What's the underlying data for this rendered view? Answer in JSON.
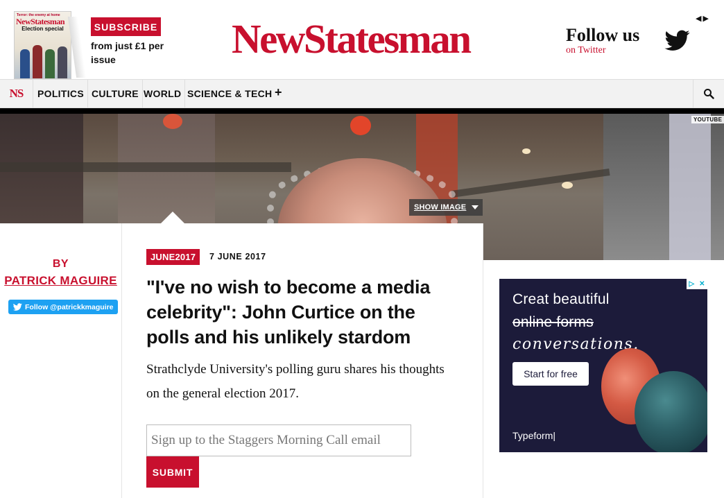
{
  "header": {
    "cover": {
      "top_line": "Terror: the enemy at home",
      "masthead": "NewStatesman",
      "headline": "Election special"
    },
    "subscribe_label": "SUBSCRIBE",
    "subscribe_price": "from just £1 per issue",
    "logo": "NewStatesman",
    "follow_title": "Follow us",
    "follow_sub": "on Twitter",
    "carousel_arrows": "◀▶"
  },
  "nav": {
    "logo": "NS",
    "items": [
      "POLITICS",
      "CULTURE",
      "WORLD",
      "SCIENCE & TECH"
    ],
    "more": "+"
  },
  "hero": {
    "youtube_tag": "YOUTUBE",
    "show_image_label": "SHOW IMAGE"
  },
  "byline": {
    "by": "BY",
    "author": "PATRICK MAGUIRE",
    "twitter_follow": "Follow @patrickkmaguire"
  },
  "article": {
    "tag": "JUNE2017",
    "date": "7 JUNE 2017",
    "headline": "\"I've no wish to become a media celebrity\": John Curtice on the polls and his unlikely stardom",
    "standfirst": "Strathclyde University's polling guru shares his thoughts on the general election 2017.",
    "email_placeholder": "Sign up to the Staggers Morning Call email",
    "submit_label": "SUBMIT"
  },
  "ad": {
    "line1": "Creat beautiful",
    "line2": "online forms",
    "line3": "conversations.",
    "button": "Start for free",
    "brand": "Typeform|"
  },
  "colors": {
    "brand_red": "#c8102e",
    "twitter_blue": "#1da1f2",
    "ad_bg": "#1c1b3a"
  }
}
